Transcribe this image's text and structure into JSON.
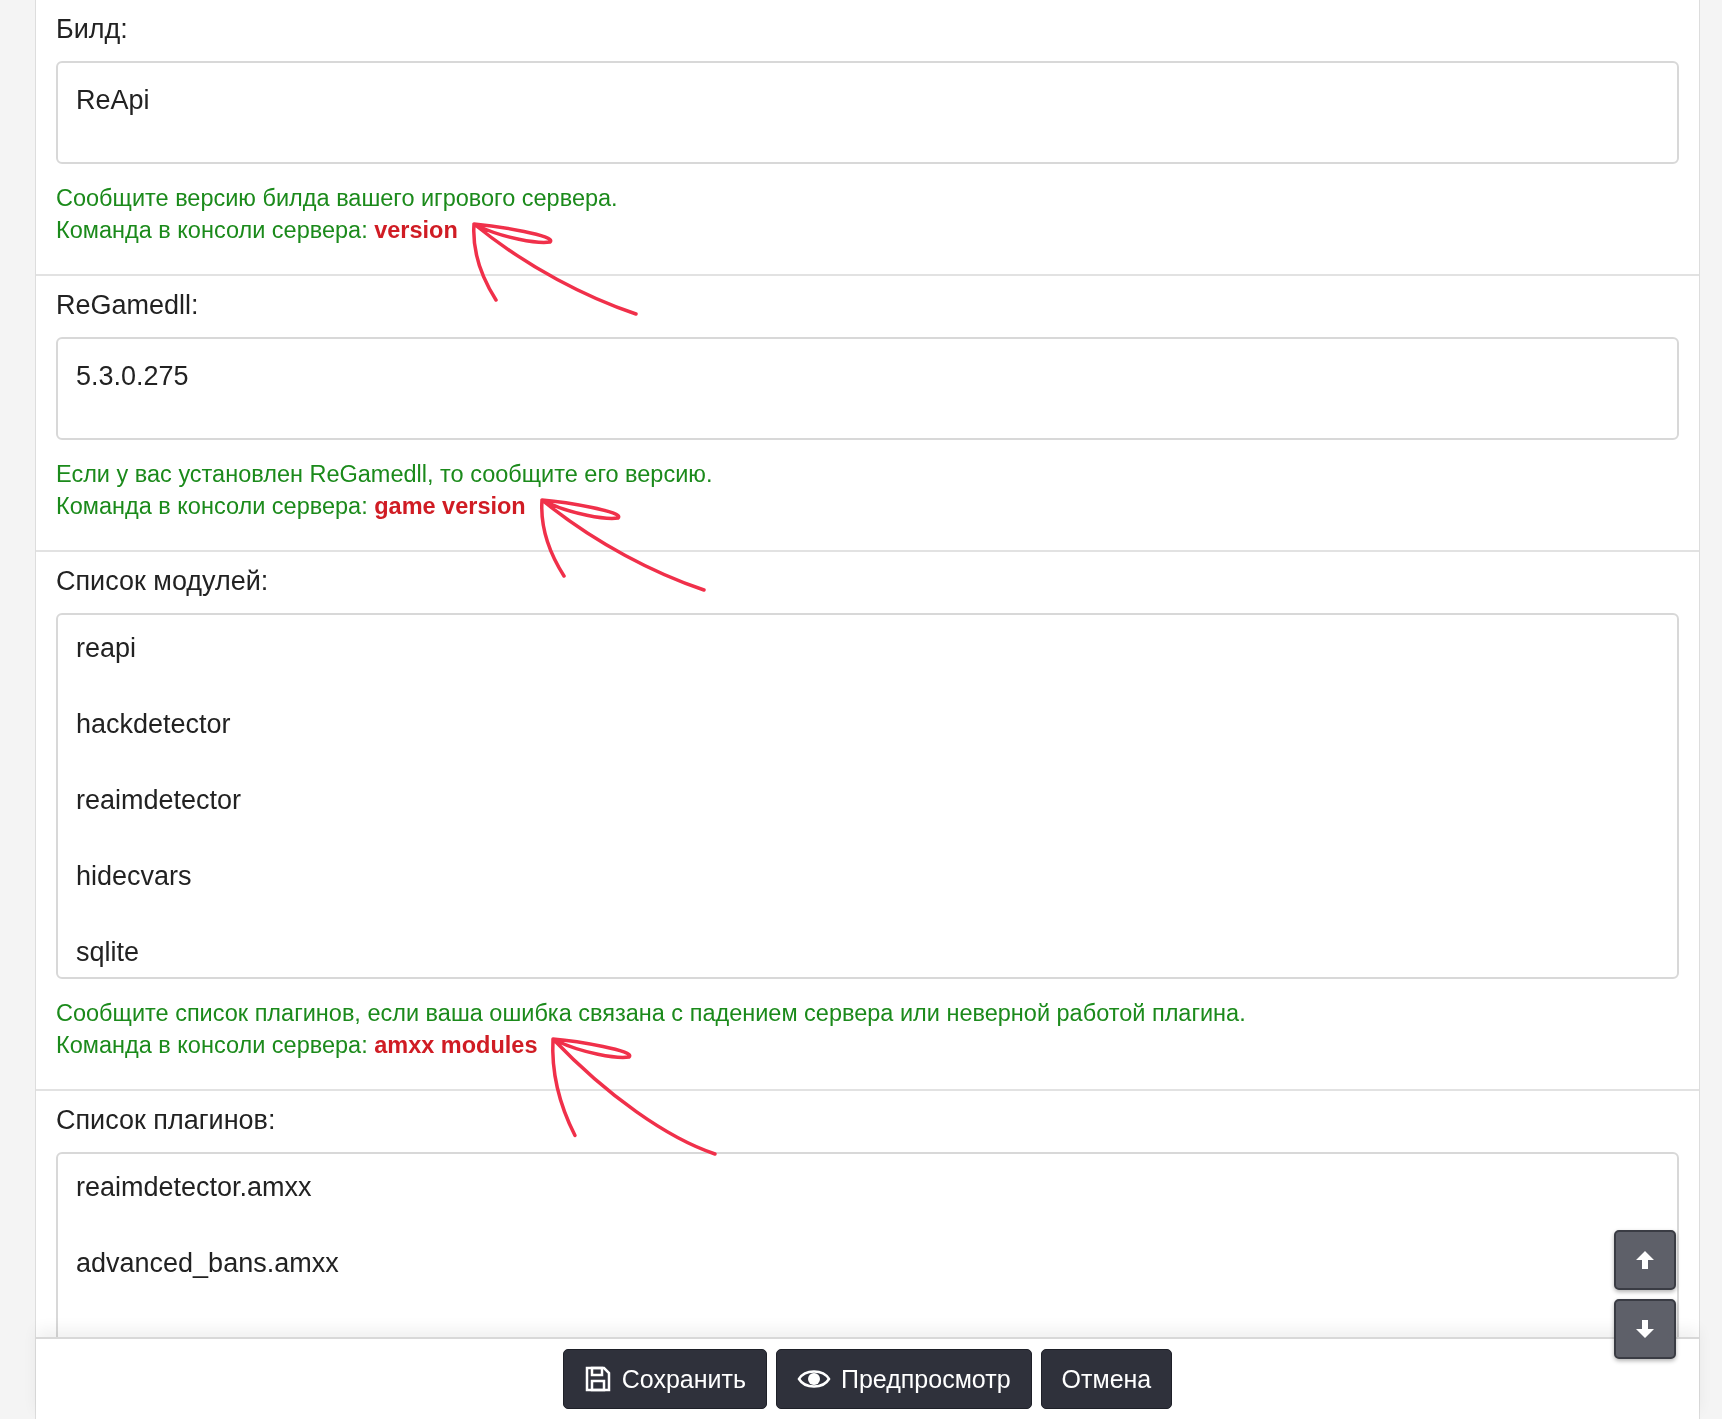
{
  "fields": [
    {
      "kind": "input",
      "label": "Билд:",
      "value": "ReApi",
      "hint": "Сообщите версию билда вашего игрового сервера.",
      "command_line": "Команда в консоли сервера: **version**"
    },
    {
      "kind": "input",
      "label": "ReGamedll:",
      "value": "5.3.0.275",
      "hint": "Если у вас установлен ReGamedll, то сообщите его версию.",
      "command_line": "Команда в консоли сервера: **game version**"
    },
    {
      "kind": "textarea",
      "label": "Список модулей:",
      "lines": [
        "reapi",
        "hackdetector",
        "reaimdetector",
        "hidecvars",
        "sqlite"
      ],
      "hint": "Сообщите список плагинов, если ваша ошибка связана с падением сервера или неверной работой плагина.",
      "command_line": "Команда в консоли сервера: **amxx modules**"
    },
    {
      "kind": "textarea",
      "label": "Список плагинов:",
      "lines": [
        "reaimdetector.amxx",
        "advanced_bans.amxx"
      ]
    }
  ],
  "buttons": [
    {
      "kind": "save",
      "label": "Сохранить"
    },
    {
      "kind": "preview",
      "label": "Предпросмотр"
    },
    {
      "kind": "cancel",
      "label": "Отмена"
    }
  ]
}
